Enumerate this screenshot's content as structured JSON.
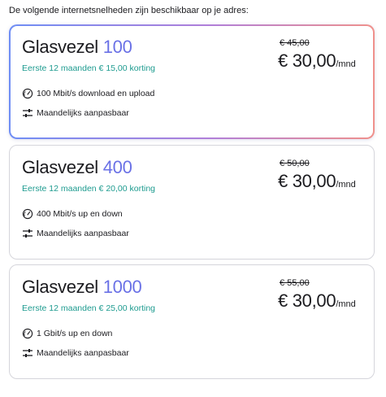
{
  "intro": "De volgende internetsnelheden zijn beschikbaar op je adres:",
  "plans": [
    {
      "name": "Glasvezel",
      "speed": "100",
      "discount": "Eerste 12 maanden € 15,00 korting",
      "old_price": "€ 45,00",
      "price": "€ 30,00",
      "unit": "/mnd",
      "speed_feature": "100 Mbit/s download en upload",
      "flex_feature": "Maandelijks aanpasbaar",
      "selected": true
    },
    {
      "name": "Glasvezel",
      "speed": "400",
      "discount": "Eerste 12 maanden € 20,00 korting",
      "old_price": "€ 50,00",
      "price": "€ 30,00",
      "unit": "/mnd",
      "speed_feature": "400 Mbit/s up en down",
      "flex_feature": "Maandelijks aanpasbaar",
      "selected": false
    },
    {
      "name": "Glasvezel",
      "speed": "1000",
      "discount": "Eerste 12 maanden € 25,00 korting",
      "old_price": "€ 55,00",
      "price": "€ 30,00",
      "unit": "/mnd",
      "speed_feature": "1 Gbit/s up en down",
      "flex_feature": "Maandelijks aanpasbaar",
      "selected": false
    }
  ],
  "colors": {
    "speed_accent": "#6a71e6",
    "discount": "#1d9b8f",
    "border": "#d5d5db"
  },
  "icons": {
    "speed": "speedometer-icon",
    "flex": "sliders-icon"
  }
}
